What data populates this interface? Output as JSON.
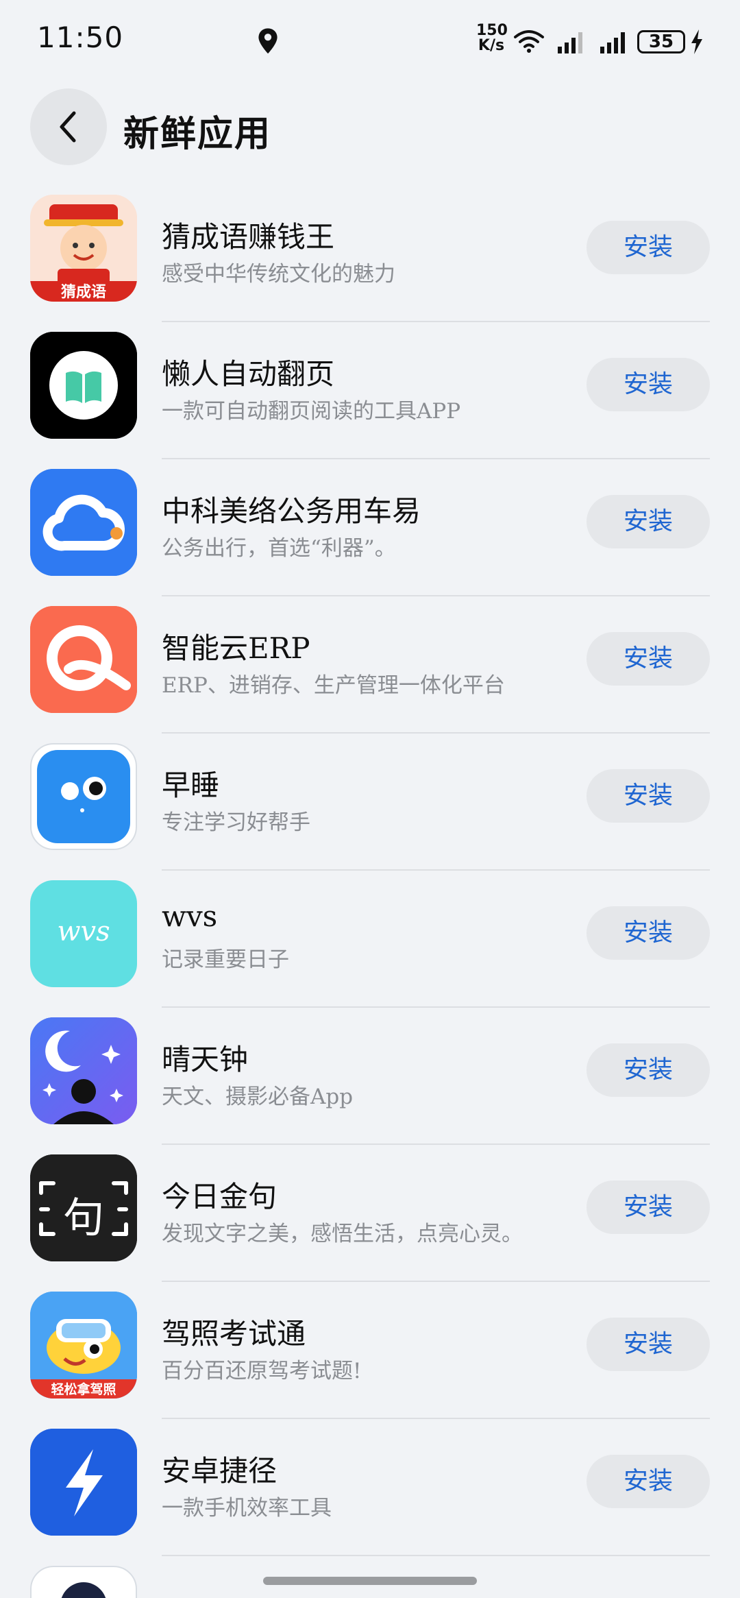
{
  "status_bar": {
    "time": "11:50",
    "net_speed_value": "150",
    "net_speed_unit": "K/s",
    "battery": "35"
  },
  "header": {
    "title": "新鲜应用"
  },
  "apps": [
    {
      "name": "猜成语赚钱王",
      "desc": "感受中华传统文化的魅力",
      "button": "安装",
      "icon_label": "猜成语"
    },
    {
      "name": "懒人自动翻页",
      "desc": "一款可自动翻页阅读的工具APP",
      "button": "安装"
    },
    {
      "name": "中科美络公务用车易",
      "desc": "公务出行，首选“利器”。",
      "button": "安装"
    },
    {
      "name": "智能云ERP",
      "desc": "ERP、进销存、生产管理一体化平台",
      "button": "安装"
    },
    {
      "name": "早睡",
      "desc": "专注学习好帮手",
      "button": "安装"
    },
    {
      "name": "wvs",
      "desc": "记录重要日子",
      "button": "安装",
      "icon_label": "wvs"
    },
    {
      "name": "晴天钟",
      "desc": "天文、摄影必备App",
      "button": "安装"
    },
    {
      "name": "今日金句",
      "desc": "发现文字之美，感悟生活，点亮心灵。",
      "button": "安装",
      "icon_label": "句"
    },
    {
      "name": "驾照考试通",
      "desc": "百分百还原驾考试题!",
      "button": "安装",
      "icon_label": "轻松拿驾照"
    },
    {
      "name": "安卓捷径",
      "desc": "一款手机效率工具",
      "button": "安装"
    }
  ],
  "colors": {
    "background": "#f1f3f6",
    "install_text": "#1f66d1",
    "install_bg": "#e5e7ea"
  }
}
